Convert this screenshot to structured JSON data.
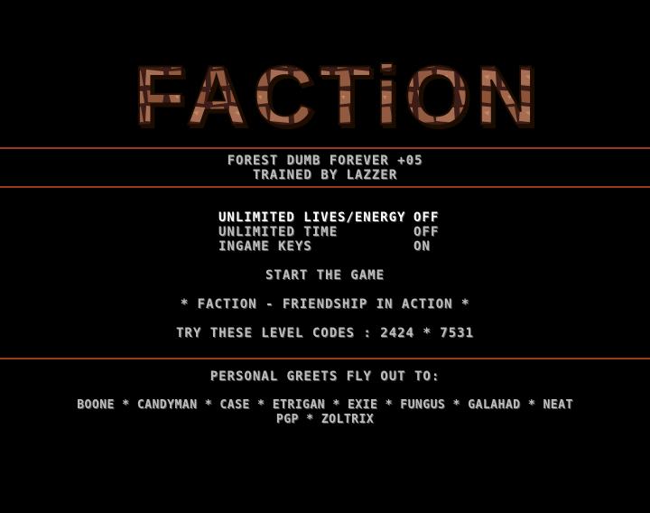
{
  "logo": {
    "text": "FACTiON"
  },
  "header": {
    "line1": "FOREST DUMB FOREVER +05",
    "line2": "TRAINED BY LAZZER"
  },
  "options": [
    {
      "label": "UNLIMITED LIVES/ENERGY",
      "value": "OFF",
      "selected": true
    },
    {
      "label": "UNLIMITED TIME",
      "value": "OFF",
      "selected": false
    },
    {
      "label": "INGAME KEYS",
      "value": "ON",
      "selected": false
    }
  ],
  "start_label": "START THE GAME",
  "motto": "* FACTION - FRIENDSHIP IN ACTION *",
  "level_codes": "TRY THESE LEVEL CODES : 2424 * 7531",
  "greets": {
    "title": "PERSONAL GREETS FLY OUT TO:",
    "line1": "BOONE * CANDYMAN * CASE * ETRIGAN * EXIE * FUNGUS * GALAHAD * NEAT",
    "line2": "PGP * ZOLTRIX"
  },
  "colors": {
    "background": "#000000",
    "rule": "#9a3a1a",
    "text": "#bdbdbd",
    "logo_stone_light": "#a0664a",
    "logo_stone_dark": "#3a1e14"
  }
}
